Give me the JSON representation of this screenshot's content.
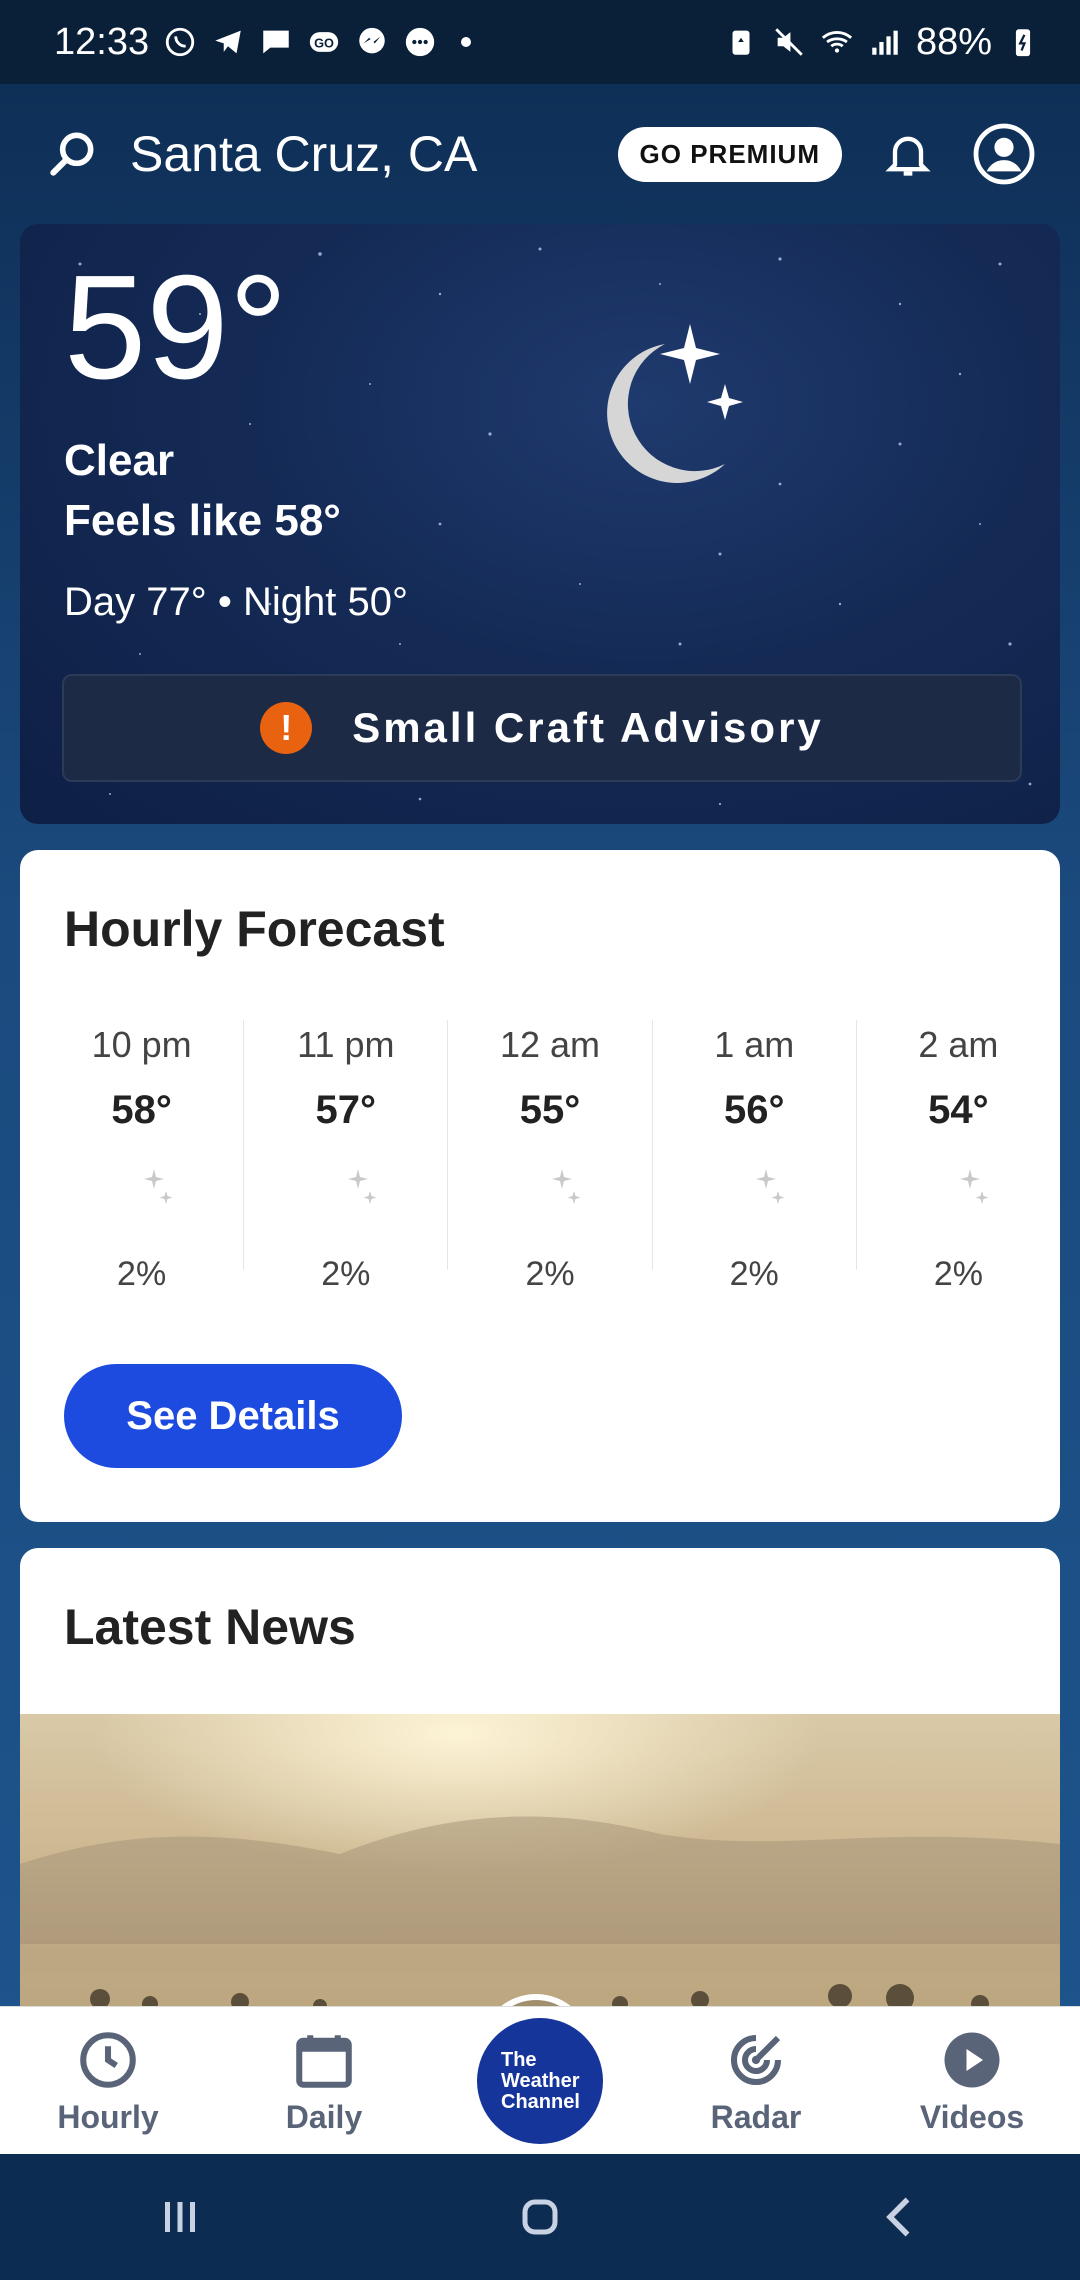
{
  "status_bar": {
    "time": "12:33",
    "battery": "88%",
    "icons": [
      "whatsapp-icon",
      "telegram-icon",
      "chat-icon",
      "go-icon",
      "messenger-icon",
      "message-icon",
      "battery-saver-icon",
      "mute-icon",
      "wifi-icon",
      "signal-icon",
      "battery-icon"
    ]
  },
  "header": {
    "location": "Santa Cruz, CA",
    "premium_label": "GO PREMIUM"
  },
  "current": {
    "temperature": "59°",
    "condition": "Clear",
    "feels_like": "Feels like 58°",
    "day_night": "Day 77° • Night 50°",
    "advisory_icon": "!",
    "advisory": "Small Craft Advisory"
  },
  "hourly": {
    "title": "Hourly Forecast",
    "hours": [
      {
        "time": "10 pm",
        "temp": "58°",
        "precip": "2%"
      },
      {
        "time": "11 pm",
        "temp": "57°",
        "precip": "2%"
      },
      {
        "time": "12 am",
        "temp": "55°",
        "precip": "2%"
      },
      {
        "time": "1 am",
        "temp": "56°",
        "precip": "2%"
      },
      {
        "time": "2 am",
        "temp": "54°",
        "precip": "2%"
      }
    ],
    "details_label": "See Details"
  },
  "news": {
    "title": "Latest News"
  },
  "tabs": {
    "hourly": "Hourly",
    "daily": "Daily",
    "center_line1": "The",
    "center_line2": "Weather",
    "center_line3": "Channel",
    "radar": "Radar",
    "videos": "Videos"
  },
  "colors": {
    "accent": "#1d4be0",
    "advisory": "#e8620f",
    "brand": "#16359b"
  }
}
